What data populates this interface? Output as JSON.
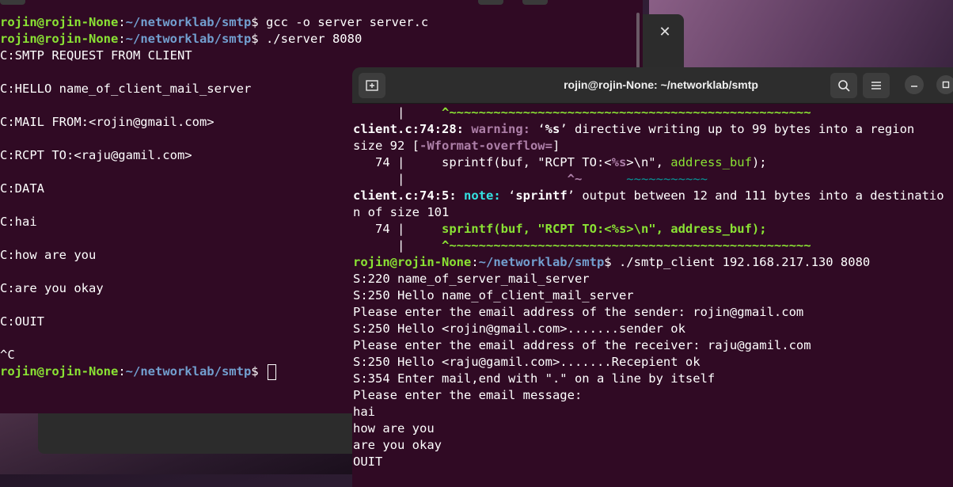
{
  "prompt": {
    "user": "rojin@rojin-None",
    "sep": ":",
    "path": "~/networklab/smtp",
    "sym": "$ "
  },
  "left_terminal": {
    "cmd1": "gcc -o server server.c",
    "cmd2": "./server 8080",
    "output": [
      "C:SMTP REQUEST FROM CLIENT",
      "",
      "C:HELLO name_of_client_mail_server",
      "",
      "C:MAIL FROM:<rojin@gmail.com>",
      "",
      "C:RCPT TO:<raju@gamil.com>",
      "",
      "C:DATA",
      "",
      "C:hai",
      "",
      "C:how are you",
      "",
      "C:are you okay",
      "",
      "C:OUIT",
      "",
      "^C"
    ]
  },
  "right_terminal": {
    "title": "rojin@rojin-None: ~/networklab/smtp",
    "buttons": {
      "new_tab": "new-tab-icon",
      "search": "search-icon",
      "menu": "hamburger-icon",
      "minimize": "minimize-icon",
      "maximize": "maximize-icon"
    },
    "warn1_pre": "      |     ",
    "warn1_caret": "^~~~~~~~~~~~~~~~~~~~~~~~~~~~~~~~~~~~~~~~~~~~~~~~~~",
    "warn_loc": "client.c:74:28:",
    "warn_label": "warning:",
    "warn_text_a": " ‘",
    "warn_text_b": "%s",
    "warn_text_c": "’ directive writing up to 99 bytes into a region",
    "warn_line2_a": "size 92 [",
    "warn_flag": "-Wformat-overflow=",
    "warn_line2_b": "]",
    "src1_no": "   74 | ",
    "src1_a": "    sprintf(buf, \"RCPT TO:<",
    "src1_fmt": "%s",
    "src1_b": ">\\n\", ",
    "src1_arg": "address_buf",
    "src1_c": ");",
    "caret2_pre": "      |                      ",
    "caret2_a": "^~",
    "caret2_gap": "      ",
    "caret2_b": "~~~~~~~~~~~",
    "note_loc": "client.c:74:5:",
    "note_label": "note:",
    "note_text_a": " ‘",
    "note_text_b": "sprintf",
    "note_text_c": "’ output between 12 and 111 bytes into a destinatio",
    "note_line2": "n of size 101",
    "src2_no": "   74 | ",
    "src2_code": "    sprintf(buf, \"RCPT TO:<%s>\\n\", address_buf);",
    "caret3_pre": "      |     ",
    "caret3": "^~~~~~~~~~~~~~~~~~~~~~~~~~~~~~~~~~~~~~~~~~~~~~~~~~",
    "run_cmd": "./smtp_client 192.168.217.130 8080",
    "output": [
      "S:220 name_of_server_mail_server",
      "S:250 Hello name_of_client_mail_server",
      "Please enter the email address of the sender: rojin@gmail.com",
      "S:250 Hello <rojin@gmail.com>.......sender ok",
      "Please enter the email address of the receiver: raju@gamil.com",
      "S:250 Hello <raju@gamil.com>.......Recepient ok",
      "S:354 Enter mail,end with \".\" on a line by itself",
      "Please enter the email message:",
      "hai",
      "how are you",
      "are you okay",
      "OUIT"
    ]
  },
  "back_window": {
    "close_glyph": "✕"
  },
  "colors": {
    "terminal_bg": "#300a24",
    "user": "#8ae234",
    "path": "#729fcf",
    "warning": "#ad7fa8",
    "titlebar": "#2d2d2d"
  }
}
